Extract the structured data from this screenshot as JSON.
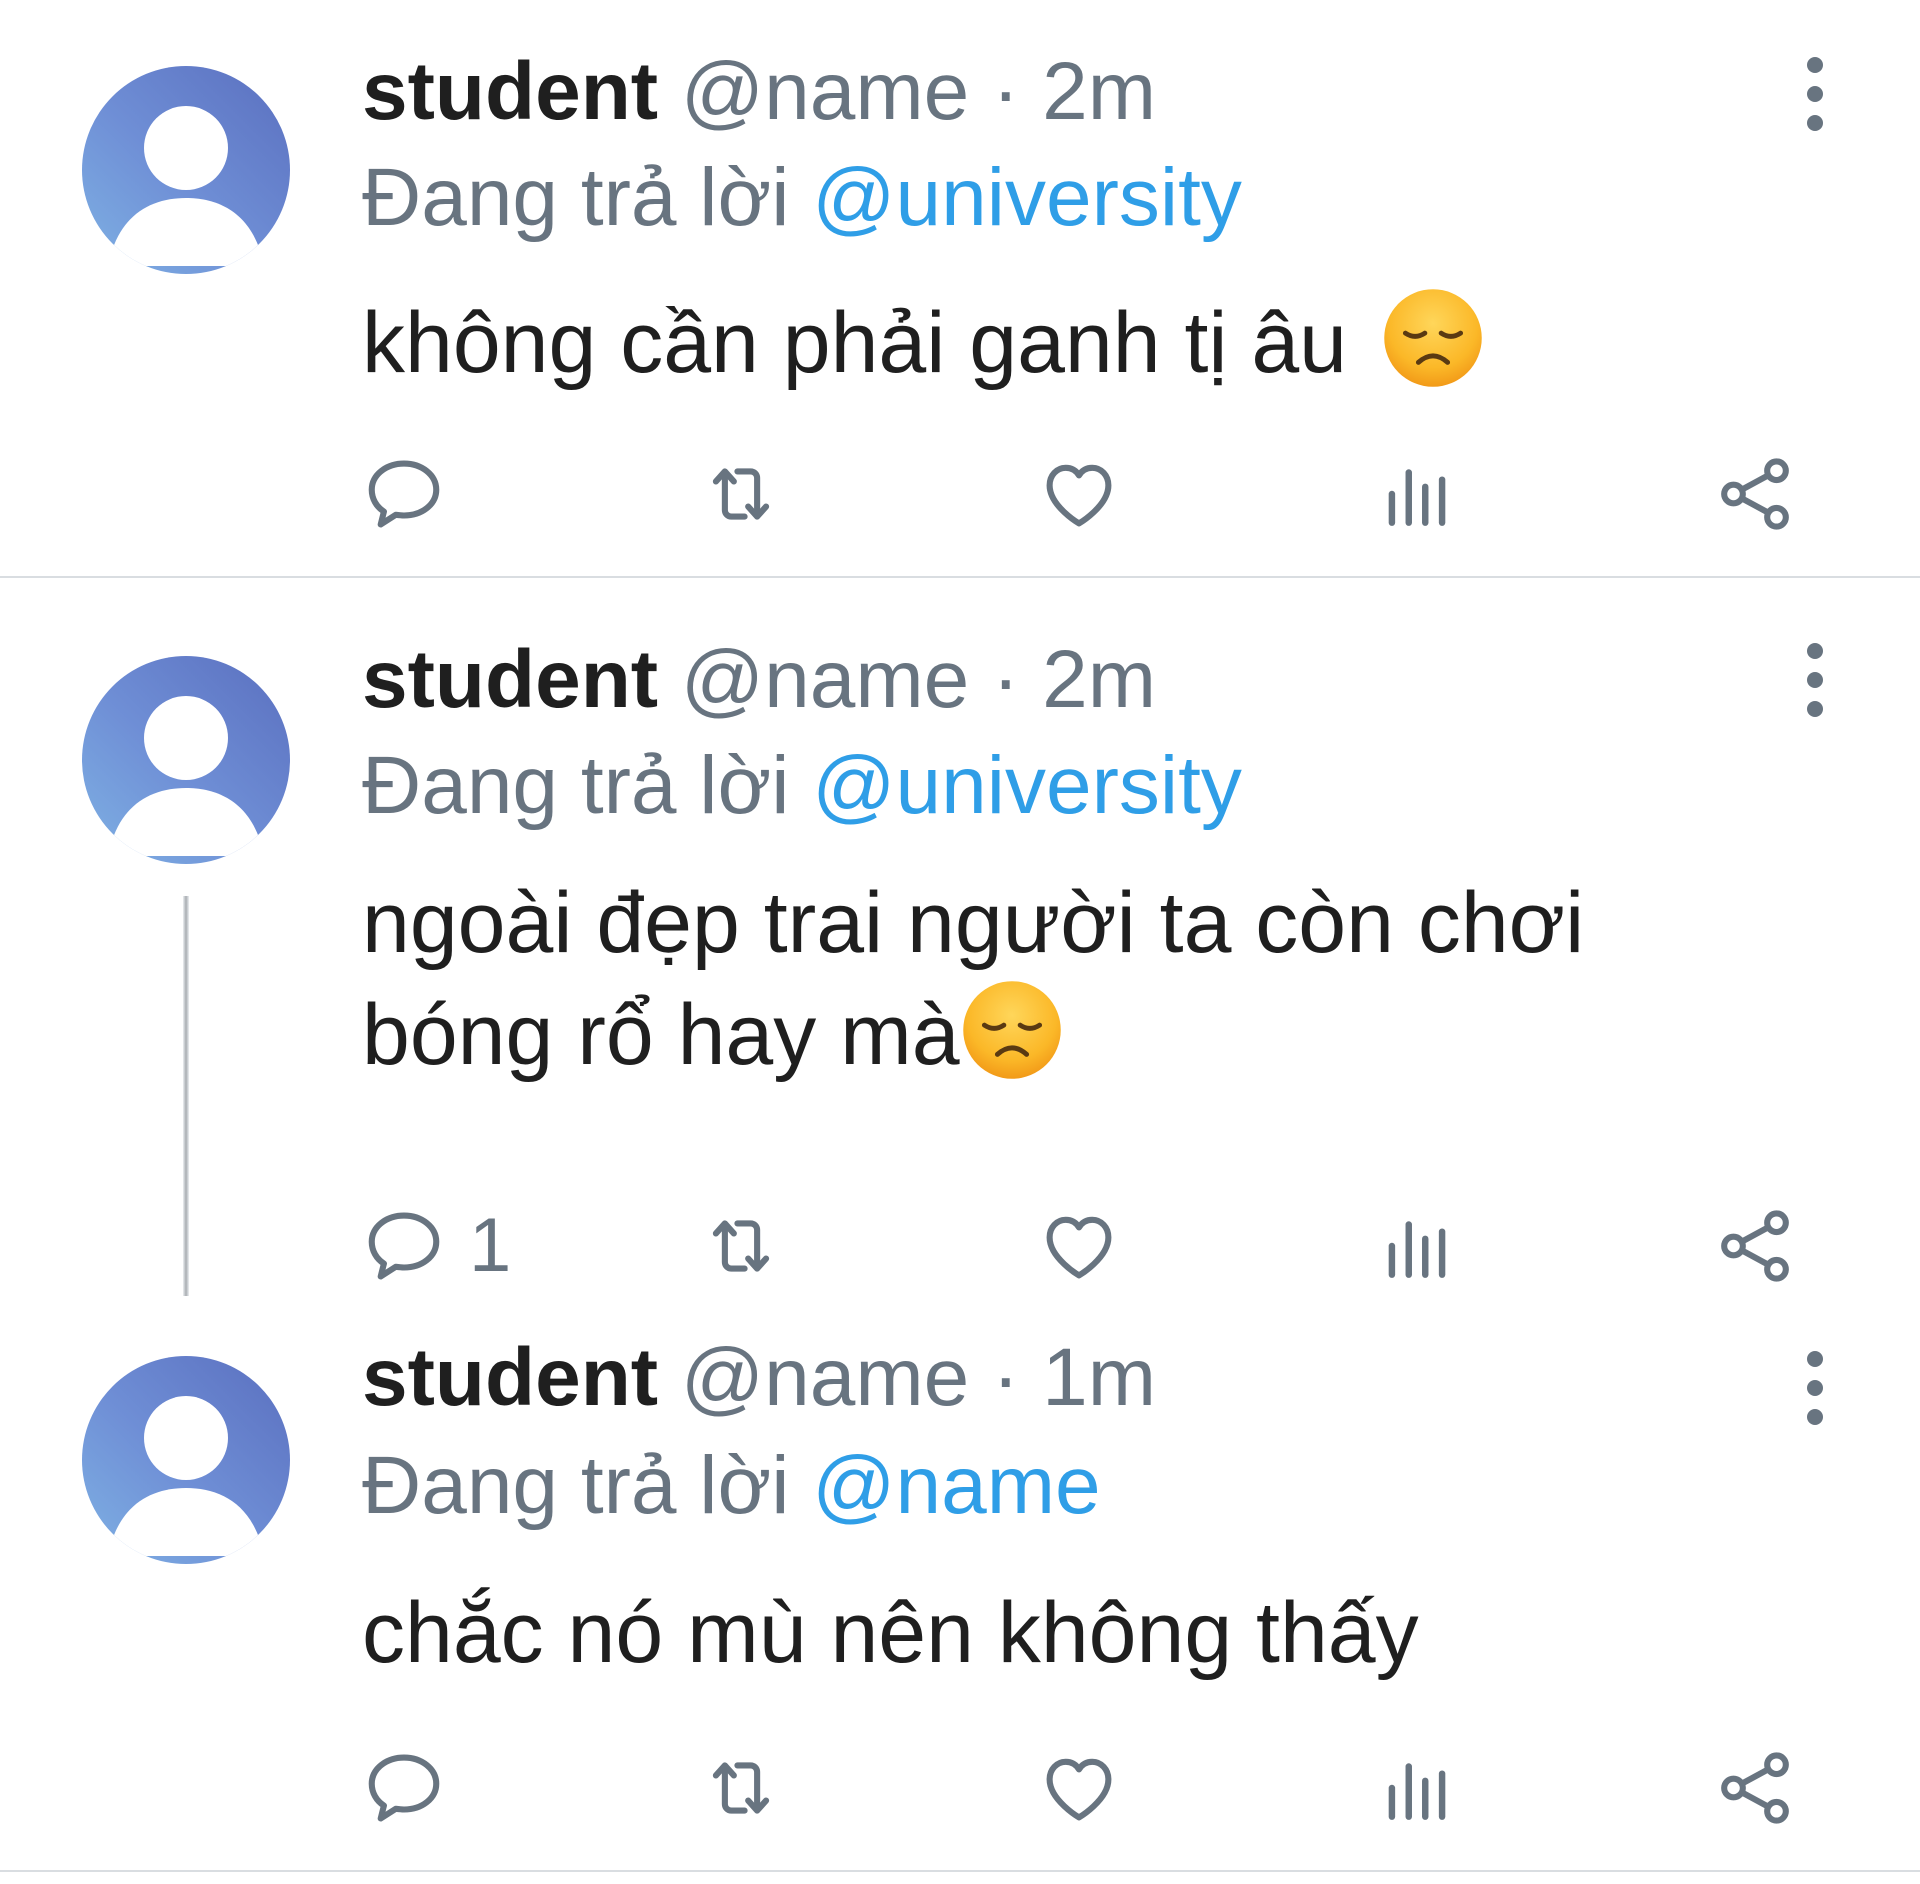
{
  "tweets": [
    {
      "display_name": "student",
      "handle": "@name",
      "separator": "·",
      "time": "2m",
      "replying_prefix": "Đang trả lời",
      "replying_to": "@university",
      "text": "không cần phải ganh tị âu",
      "emoji": "disappointed-face",
      "reply_count": ""
    },
    {
      "display_name": "student",
      "handle": "@name",
      "separator": "·",
      "time": "2m",
      "replying_prefix": "Đang trả lời",
      "replying_to": "@university",
      "text_line1": "ngoài đẹp trai người ta còn chơi",
      "text_line2": "bóng rổ hay mà",
      "emoji": "disappointed-face",
      "reply_count": "1"
    },
    {
      "display_name": "student",
      "handle": "@name",
      "separator": "·",
      "time": "1m",
      "replying_prefix": "Đang trả lời",
      "replying_to": "@name",
      "text": "chắc nó mù nên không thấy",
      "reply_count": ""
    }
  ],
  "colors": {
    "text": "#1f1f1f",
    "muted": "#687480",
    "mention": "#2f9ee7",
    "icon": "#687480",
    "divider": "#d9dde1"
  }
}
